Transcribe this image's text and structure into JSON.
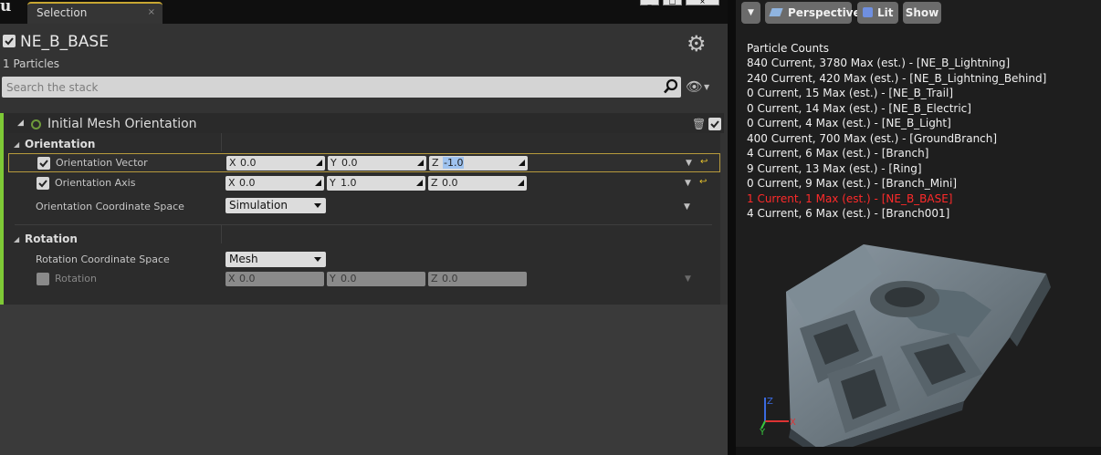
{
  "window": {
    "logo": "u",
    "tab_label": "Selection",
    "tab_close": "×",
    "controls": [
      "_",
      "□",
      "×"
    ]
  },
  "details": {
    "emitter_name": "NE_B_BASE",
    "particle_count": "1 Particles",
    "search_placeholder": "Search the stack"
  },
  "module": {
    "title": "Initial Mesh Orientation",
    "orientation": {
      "section_title": "Orientation",
      "rows": [
        {
          "label": "Orientation Vector",
          "x": "0.0",
          "y": "0.0",
          "z": "-1.0"
        },
        {
          "label": "Orientation Axis",
          "x": "0.0",
          "y": "1.0",
          "z": "0.0"
        }
      ],
      "coord_space_label": "Orientation Coordinate Space",
      "coord_space_value": "Simulation"
    },
    "rotation": {
      "section_title": "Rotation",
      "coord_space_label": "Rotation Coordinate Space",
      "coord_space_value": "Mesh",
      "rotation_label": "Rotation",
      "x": "0.0",
      "y": "0.0",
      "z": "0.0"
    },
    "axis_letters": {
      "x": "X",
      "y": "Y",
      "z": "Z"
    }
  },
  "viewport": {
    "buttons": {
      "perspective": "Perspective",
      "lit": "Lit",
      "show": "Show"
    },
    "stats_title": "Particle Counts",
    "stats": [
      "840 Current, 3780 Max (est.) - [NE_B_Lightning]",
      "240 Current, 420 Max (est.) - [NE_B_Lightning_Behind]",
      "0 Current, 15 Max (est.) - [NE_B_Trail]",
      "0 Current, 14 Max (est.) - [NE_B_Electric]",
      "0 Current, 4 Max (est.) - [NE_B_Light]",
      "400 Current, 700 Max (est.) - [GroundBranch]",
      "4 Current, 6 Max (est.) - [Branch]",
      "9 Current, 13 Max (est.) - [Ring]",
      "0 Current, 9 Max (est.) - [Branch_Mini]",
      "1 Current, 1 Max (est.) - [NE_B_BASE]",
      "4 Current, 6 Max (est.) - [Branch001]"
    ],
    "highlight_index": 9,
    "gizmo": {
      "x": "X",
      "y": "Y",
      "z": "Z"
    }
  },
  "colors": {
    "module_accent": "#7ec936",
    "tab_accent": "#c7a632",
    "highlight_stat": "#ff2a2a",
    "selected_row_border": "#b79a3c"
  }
}
